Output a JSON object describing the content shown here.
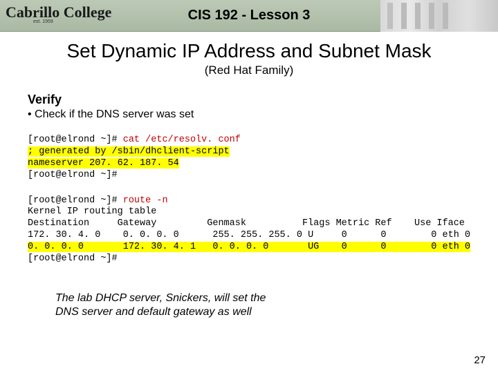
{
  "header": {
    "logo_text": "Cabrillo College",
    "logo_sub": "est. 1959",
    "title": "CIS 192 - Lesson 3"
  },
  "main": {
    "title": "Set Dynamic IP Address and Subnet Mask",
    "subtitle": "(Red Hat Family)",
    "verify_heading": "Verify",
    "verify_bullet": "• Check if the DNS server was set"
  },
  "term1": {
    "prompt1": "[root@elrond ~]# ",
    "cmd1": "cat /etc/resolv. conf",
    "hl_line1": "; generated by /sbin/dhclient-script",
    "hl_line2": "nameserver 207. 62. 187. 54",
    "prompt2": "[root@elrond ~]#"
  },
  "term2": {
    "prompt1": "[root@elrond ~]# ",
    "cmd1": "route -n",
    "line_kernel": "Kernel IP routing table",
    "hdr": "Destination     Gateway         Genmask          Flags Metric Ref    Use Iface",
    "row1": "172. 30. 4. 0    0. 0. 0. 0      255. 255. 255. 0 U     0      0        0 eth 0",
    "row2_a": "0. 0. 0. 0       172. 30. 4. 1   0. 0. 0. 0       UG    0      0        0 ",
    "row2_b": "eth 0",
    "prompt2": "[root@elrond ~]#"
  },
  "note": {
    "line1": "The lab DHCP server, Snickers, will set the",
    "line2": "DNS server and default gateway as well"
  },
  "pagenum": "27"
}
